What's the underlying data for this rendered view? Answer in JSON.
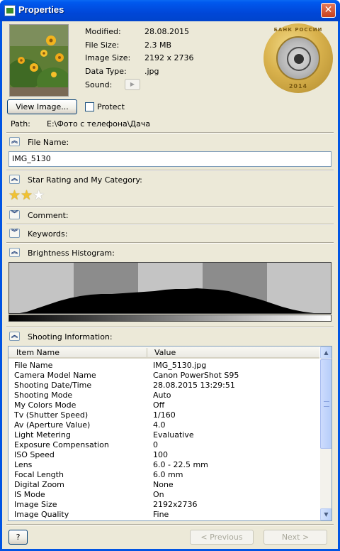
{
  "window": {
    "title": "Properties",
    "close_symbol": "✕"
  },
  "metadata": [
    {
      "label": "Modified:",
      "value": "28.08.2015"
    },
    {
      "label": "File Size:",
      "value": "2.3 MB"
    },
    {
      "label": "Image Size:",
      "value": "2192 x 2736"
    },
    {
      "label": "Data Type:",
      "value": ".jpg"
    },
    {
      "label": "Sound:",
      "value": ""
    }
  ],
  "coin": {
    "top_text": "БАНК РОССИИ",
    "bottom_text": "2014"
  },
  "buttons": {
    "view_image": "View Image...",
    "previous": "Previous",
    "next": "Next",
    "help": "?"
  },
  "protect": {
    "label": "Protect",
    "checked": false
  },
  "path": {
    "label": "Path:",
    "value": "E:\\Фото с телефона\\Дача"
  },
  "sections": {
    "file_name": "File Name:",
    "star_rating": "Star Rating and My Category:",
    "comment": "Comment:",
    "keywords": "Keywords:",
    "histogram": "Brightness Histogram:",
    "shooting_info": "Shooting Information:"
  },
  "file_name_value": "IMG_5130",
  "rating": {
    "stars": 2,
    "max": 5
  },
  "shooting_table": {
    "columns": [
      "Item Name",
      "Value"
    ],
    "rows": [
      [
        "File Name",
        "IMG_5130.jpg"
      ],
      [
        "Camera Model Name",
        "Canon PowerShot S95"
      ],
      [
        "Shooting Date/Time",
        "28.08.2015 13:29:51"
      ],
      [
        "Shooting Mode",
        "Auto"
      ],
      [
        "My Colors Mode",
        "Off"
      ],
      [
        "Tv (Shutter Speed)",
        "1/160"
      ],
      [
        "Av (Aperture Value)",
        "4.0"
      ],
      [
        "Light Metering",
        "Evaluative"
      ],
      [
        "Exposure Compensation",
        "0"
      ],
      [
        "ISO Speed",
        "100"
      ],
      [
        "Lens",
        "6.0 - 22.5 mm"
      ],
      [
        "Focal Length",
        "6.0 mm"
      ],
      [
        "Digital Zoom",
        "None"
      ],
      [
        "IS Mode",
        "On"
      ],
      [
        "Image Size",
        "2192x2736"
      ],
      [
        "Image Quality",
        "Fine"
      ]
    ]
  },
  "colors": {
    "titlebar": "#0054e3",
    "dialog_bg": "#ece9d8",
    "star": "#f1c232"
  }
}
